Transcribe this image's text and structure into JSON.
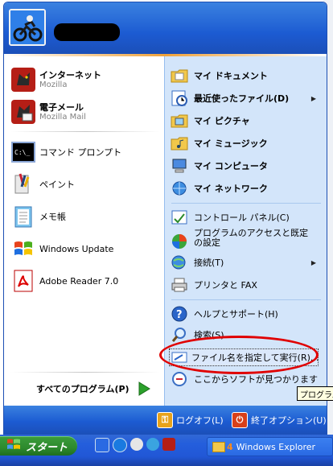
{
  "user": {
    "name_redacted": ""
  },
  "left_pinned": [
    {
      "title": "インターネット",
      "subtitle": "Mozilla",
      "icon": "mozilla-icon"
    },
    {
      "title": "電子メール",
      "subtitle": "Mozilla Mail",
      "icon": "mozilla-mail-icon"
    }
  ],
  "left_recent": [
    {
      "title": "コマンド プロンプト",
      "icon": "command-prompt-icon"
    },
    {
      "title": "ペイント",
      "icon": "paint-icon"
    },
    {
      "title": "メモ帳",
      "icon": "notepad-icon"
    },
    {
      "title": "Windows Update",
      "icon": "windows-update-icon"
    },
    {
      "title": "Adobe Reader 7.0",
      "icon": "adobe-reader-icon"
    }
  ],
  "all_programs": {
    "label": "すべてのプログラム(P)"
  },
  "right_items": {
    "my_documents": "マイ ドキュメント",
    "recent_files": "最近使ったファイル(D)",
    "my_pictures": "マイ ピクチャ",
    "my_music": "マイ ミュージック",
    "my_computer": "マイ コンピュータ",
    "my_network": "マイ ネットワーク",
    "control_panel": "コントロール パネル(C)",
    "program_access": "プログラムのアクセスと既定の設定",
    "connect": "接続(T)",
    "printers": "プリンタと FAX",
    "help": "ヘルプとサポート(H)",
    "search": "検索(S)",
    "run": "ファイル名を指定して実行(R)...",
    "find_software": "ここからソフトが見つかります"
  },
  "footer": {
    "logoff": "ログオフ(L)",
    "shutdown": "終了オプション(U)"
  },
  "taskbar": {
    "start": "スタート",
    "window_title": "Windows Explorer",
    "window_count": "4"
  },
  "tooltip": {
    "text": "プログラム"
  },
  "colors": {
    "accent_blue": "#1c5bd2",
    "start_green": "#2d8a2d",
    "annotation_red": "#e00000"
  }
}
